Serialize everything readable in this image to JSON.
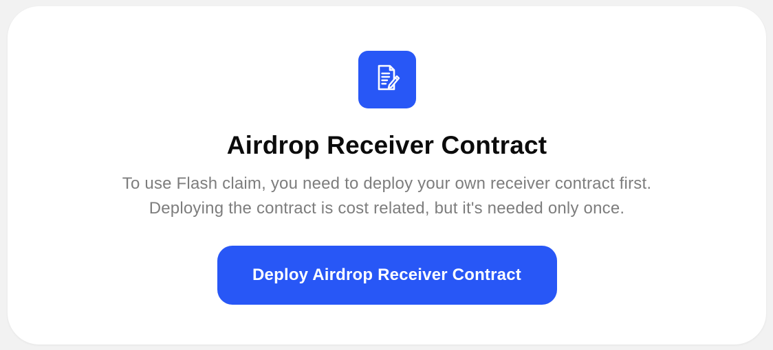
{
  "card": {
    "icon": "document-pen-icon",
    "title": "Airdrop Receiver Contract",
    "description_line1": "To use Flash claim, you need to deploy your own receiver contract first.",
    "description_line2": "Deploying the contract is cost related, but it's needed only once.",
    "button_label": "Deploy Airdrop Receiver Contract"
  },
  "colors": {
    "accent": "#2857f6",
    "background": "#f2f2f2",
    "card": "#ffffff",
    "title": "#0b0b0b",
    "description": "#7d7d7d"
  }
}
